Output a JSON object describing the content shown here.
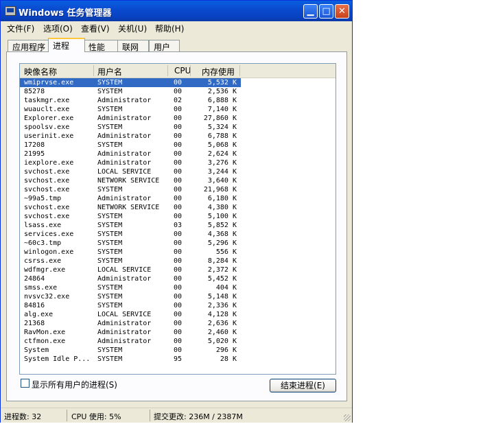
{
  "window": {
    "title": "Windows 任务管理器",
    "buttons": {
      "minimize_icon": "minimize-icon",
      "maximize_icon": "maximize-icon",
      "close_icon": "close-icon"
    }
  },
  "menu": [
    {
      "label": "文件(F)"
    },
    {
      "label": "选项(O)"
    },
    {
      "label": "查看(V)"
    },
    {
      "label": "关机(U)"
    },
    {
      "label": "帮助(H)"
    }
  ],
  "tabs": [
    {
      "label": "应用程序"
    },
    {
      "label": "进程",
      "active": true
    },
    {
      "label": "性能"
    },
    {
      "label": "联网"
    },
    {
      "label": "用户"
    }
  ],
  "columns": [
    "映像名称",
    "用户名",
    "CPU",
    "内存使用"
  ],
  "processes": [
    {
      "name": "wmiprvse.exe",
      "user": "SYSTEM",
      "cpu": "00",
      "mem": "5,532 K",
      "selected": true
    },
    {
      "name": "85278",
      "user": "SYSTEM",
      "cpu": "00",
      "mem": "2,536 K"
    },
    {
      "name": "taskmgr.exe",
      "user": "Administrator",
      "cpu": "02",
      "mem": "6,888 K"
    },
    {
      "name": "wuauclt.exe",
      "user": "SYSTEM",
      "cpu": "00",
      "mem": "7,140 K"
    },
    {
      "name": "Explorer.exe",
      "user": "Administrator",
      "cpu": "00",
      "mem": "27,860 K"
    },
    {
      "name": "spoolsv.exe",
      "user": "SYSTEM",
      "cpu": "00",
      "mem": "5,324 K"
    },
    {
      "name": "userinit.exe",
      "user": "Administrator",
      "cpu": "00",
      "mem": "6,788 K"
    },
    {
      "name": "17208",
      "user": "SYSTEM",
      "cpu": "00",
      "mem": "5,068 K"
    },
    {
      "name": "21995",
      "user": "Administrator",
      "cpu": "00",
      "mem": "2,624 K"
    },
    {
      "name": "iexplore.exe",
      "user": "Administrator",
      "cpu": "00",
      "mem": "3,276 K"
    },
    {
      "name": "svchost.exe",
      "user": "LOCAL SERVICE",
      "cpu": "00",
      "mem": "3,244 K"
    },
    {
      "name": "svchost.exe",
      "user": "NETWORK SERVICE",
      "cpu": "00",
      "mem": "3,640 K"
    },
    {
      "name": "svchost.exe",
      "user": "SYSTEM",
      "cpu": "00",
      "mem": "21,968 K"
    },
    {
      "name": "~99a5.tmp",
      "user": "Administrator",
      "cpu": "00",
      "mem": "6,180 K"
    },
    {
      "name": "svchost.exe",
      "user": "NETWORK SERVICE",
      "cpu": "00",
      "mem": "4,380 K"
    },
    {
      "name": "svchost.exe",
      "user": "SYSTEM",
      "cpu": "00",
      "mem": "5,100 K"
    },
    {
      "name": "lsass.exe",
      "user": "SYSTEM",
      "cpu": "03",
      "mem": "5,852 K"
    },
    {
      "name": "services.exe",
      "user": "SYSTEM",
      "cpu": "00",
      "mem": "4,368 K"
    },
    {
      "name": "~60c3.tmp",
      "user": "SYSTEM",
      "cpu": "00",
      "mem": "5,296 K"
    },
    {
      "name": "winlogon.exe",
      "user": "SYSTEM",
      "cpu": "00",
      "mem": "556 K"
    },
    {
      "name": "csrss.exe",
      "user": "SYSTEM",
      "cpu": "00",
      "mem": "8,284 K"
    },
    {
      "name": "wdfmgr.exe",
      "user": "LOCAL SERVICE",
      "cpu": "00",
      "mem": "2,372 K"
    },
    {
      "name": "24864",
      "user": "Administrator",
      "cpu": "00",
      "mem": "5,452 K"
    },
    {
      "name": "smss.exe",
      "user": "SYSTEM",
      "cpu": "00",
      "mem": "404 K"
    },
    {
      "name": "nvsvc32.exe",
      "user": "SYSTEM",
      "cpu": "00",
      "mem": "5,148 K"
    },
    {
      "name": "84816",
      "user": "SYSTEM",
      "cpu": "00",
      "mem": "2,336 K"
    },
    {
      "name": "alg.exe",
      "user": "LOCAL SERVICE",
      "cpu": "00",
      "mem": "4,128 K"
    },
    {
      "name": "21368",
      "user": "Administrator",
      "cpu": "00",
      "mem": "2,636 K"
    },
    {
      "name": "RavMon.exe",
      "user": "Administrator",
      "cpu": "00",
      "mem": "2,460 K"
    },
    {
      "name": "ctfmon.exe",
      "user": "Administrator",
      "cpu": "00",
      "mem": "5,020 K"
    },
    {
      "name": "System",
      "user": "SYSTEM",
      "cpu": "00",
      "mem": "296 K"
    },
    {
      "name": "System Idle P...",
      "user": "SYSTEM",
      "cpu": "95",
      "mem": "28 K"
    }
  ],
  "show_all_users": {
    "label": "显示所有用户的进程(S)",
    "checked": false
  },
  "end_process_button": "结束进程(E)",
  "status": {
    "processes": "进程数: 32",
    "cpu": "CPU 使用: 5%",
    "commit": "提交更改: 236M / 2387M"
  }
}
